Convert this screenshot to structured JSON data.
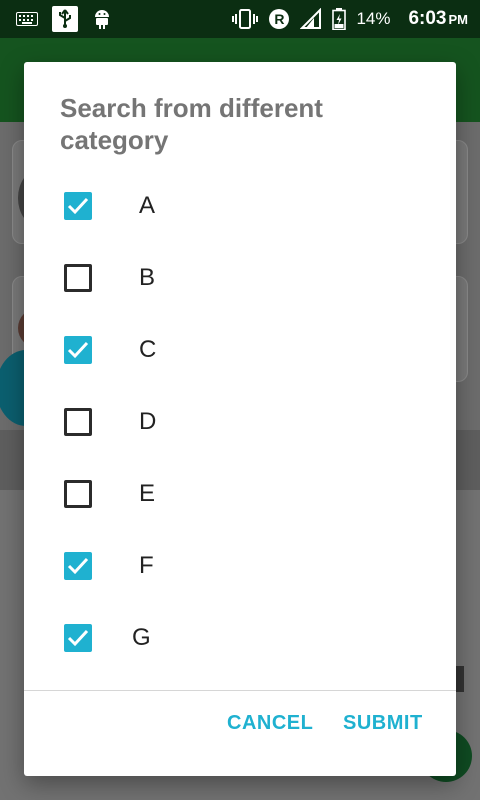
{
  "status_bar": {
    "battery": "14%",
    "time": "6:03",
    "ampm": "PM",
    "roaming": "R"
  },
  "dialog": {
    "title": "Search from different category",
    "options": [
      {
        "label": "A",
        "checked": true
      },
      {
        "label": "B",
        "checked": false
      },
      {
        "label": "C",
        "checked": true
      },
      {
        "label": "D",
        "checked": false
      },
      {
        "label": "E",
        "checked": false
      },
      {
        "label": "F",
        "checked": true
      },
      {
        "label": "G",
        "checked": true
      }
    ],
    "cancel_label": "CANCEL",
    "submit_label": "SUBMIT"
  },
  "colors": {
    "accent": "#1fb1d0",
    "status_bar": "#0b2e12",
    "toolbar": "#15541f"
  }
}
